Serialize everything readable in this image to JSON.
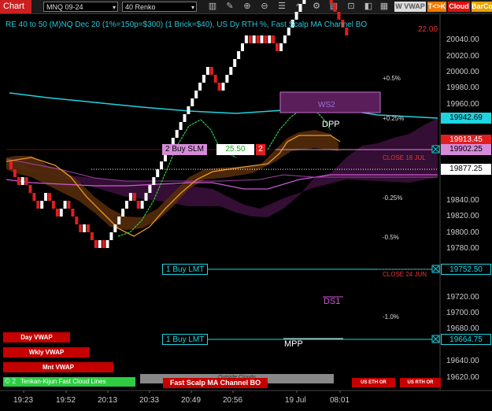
{
  "toolbar": {
    "title": "Chart",
    "instrument": "MNQ 09-24",
    "bar_type": "40 Renko",
    "icons": [
      "bar-style-icon",
      "drawing-tools-icon",
      "zoom-in-icon",
      "zoom-out-icon",
      "properties-icon",
      "indicators-icon",
      "strategies-icon",
      "templates-icon",
      "lock-icon",
      "orders-icon",
      "data-box-icon"
    ],
    "btn_vwap": "W VWAP",
    "btn_tk": "T<>K",
    "btn_cloud": "Cloud",
    "btn_barco": "BarCo"
  },
  "header": {
    "text": "RE 40 to 50 (M)NQ Dec 20 (1%=150p=$300) (1 Brick=$40), US Dy RTH %, Fast Scalp MA Channel BO",
    "overlay_price": "22.00"
  },
  "price_axis": {
    "ticks": [
      "20040.00",
      "20020.00",
      "20000.00",
      "19980.00",
      "19960.00",
      "19840.00",
      "19820.00",
      "19800.00",
      "19780.00",
      "19720.00",
      "19700.00",
      "19680.00",
      "19640.00",
      "19620.00"
    ],
    "boxes": [
      {
        "label": "19942.69",
        "bg": "#1fd3e0",
        "fg": "#000"
      },
      {
        "label": "19913.45",
        "bg": "#e01e1e",
        "fg": "#fff"
      },
      {
        "label": "19902.25",
        "bg": "#d58bd8",
        "fg": "#000"
      },
      {
        "label": "19877.25",
        "bg": "#ffffff",
        "fg": "#000"
      },
      {
        "label": "19752.50",
        "bg": "#000000",
        "fg": "#1fd3e0"
      },
      {
        "label": "19664.75",
        "bg": "#000000",
        "fg": "#1fd3e0"
      }
    ]
  },
  "time_axis": [
    "19:23",
    "19:52",
    "20:13",
    "20:33",
    "20:49",
    "20:56",
    "19 Jul",
    "08:01"
  ],
  "levels": {
    "pcts": [
      "+0.5%",
      "+0.25%",
      "-0.25%",
      "-0.5%",
      "-1.0%"
    ],
    "close_18": "CLOSE 18 JUL",
    "close_24": "CLOSE 24 JUN",
    "dpp": "DPP",
    "ds1": "DS1",
    "mpp": "MPP",
    "ws2": "WS2"
  },
  "orders": {
    "buy_slm": "2 Buy SLM",
    "buy_slm_price": "25.50",
    "buy_slm_qty": "2",
    "buy_lmt_1": "1 Buy LMT",
    "buy_lmt_2": "1 Buy LMT"
  },
  "bottom": {
    "day_vwap": "Day VWAP",
    "wkly_vwap": "Wkly VWAP",
    "mnt_vwap": "Mnt VWAP",
    "tenkan": "Tenkan-Kijun Fast Cloud Lines",
    "fast_scalp": "Fast Scalp MA Channel BO",
    "outside_clouds": "Outside Clouds",
    "us_eth": "US ETH OR",
    "us_rth": "US RTH OR",
    "copyright": "© 2"
  },
  "colors": {
    "bull_brick": "#ffffff",
    "bear_brick": "#e01e1e",
    "cyan": "#1fd3e0",
    "magenta": "#d058d8",
    "orange": "#e89a2a",
    "green": "#2ecc40"
  },
  "bricks": {
    "brick_size": 10,
    "sequence": "DDDUDDDDUUDDDUUDDDDUDDDUDUUUUUUUDDUUUUUUUUUUUUUUUUUUDDDUUUUUUUDUDUDUDDUUUUUUUUUUDDDDDDDD"
  }
}
